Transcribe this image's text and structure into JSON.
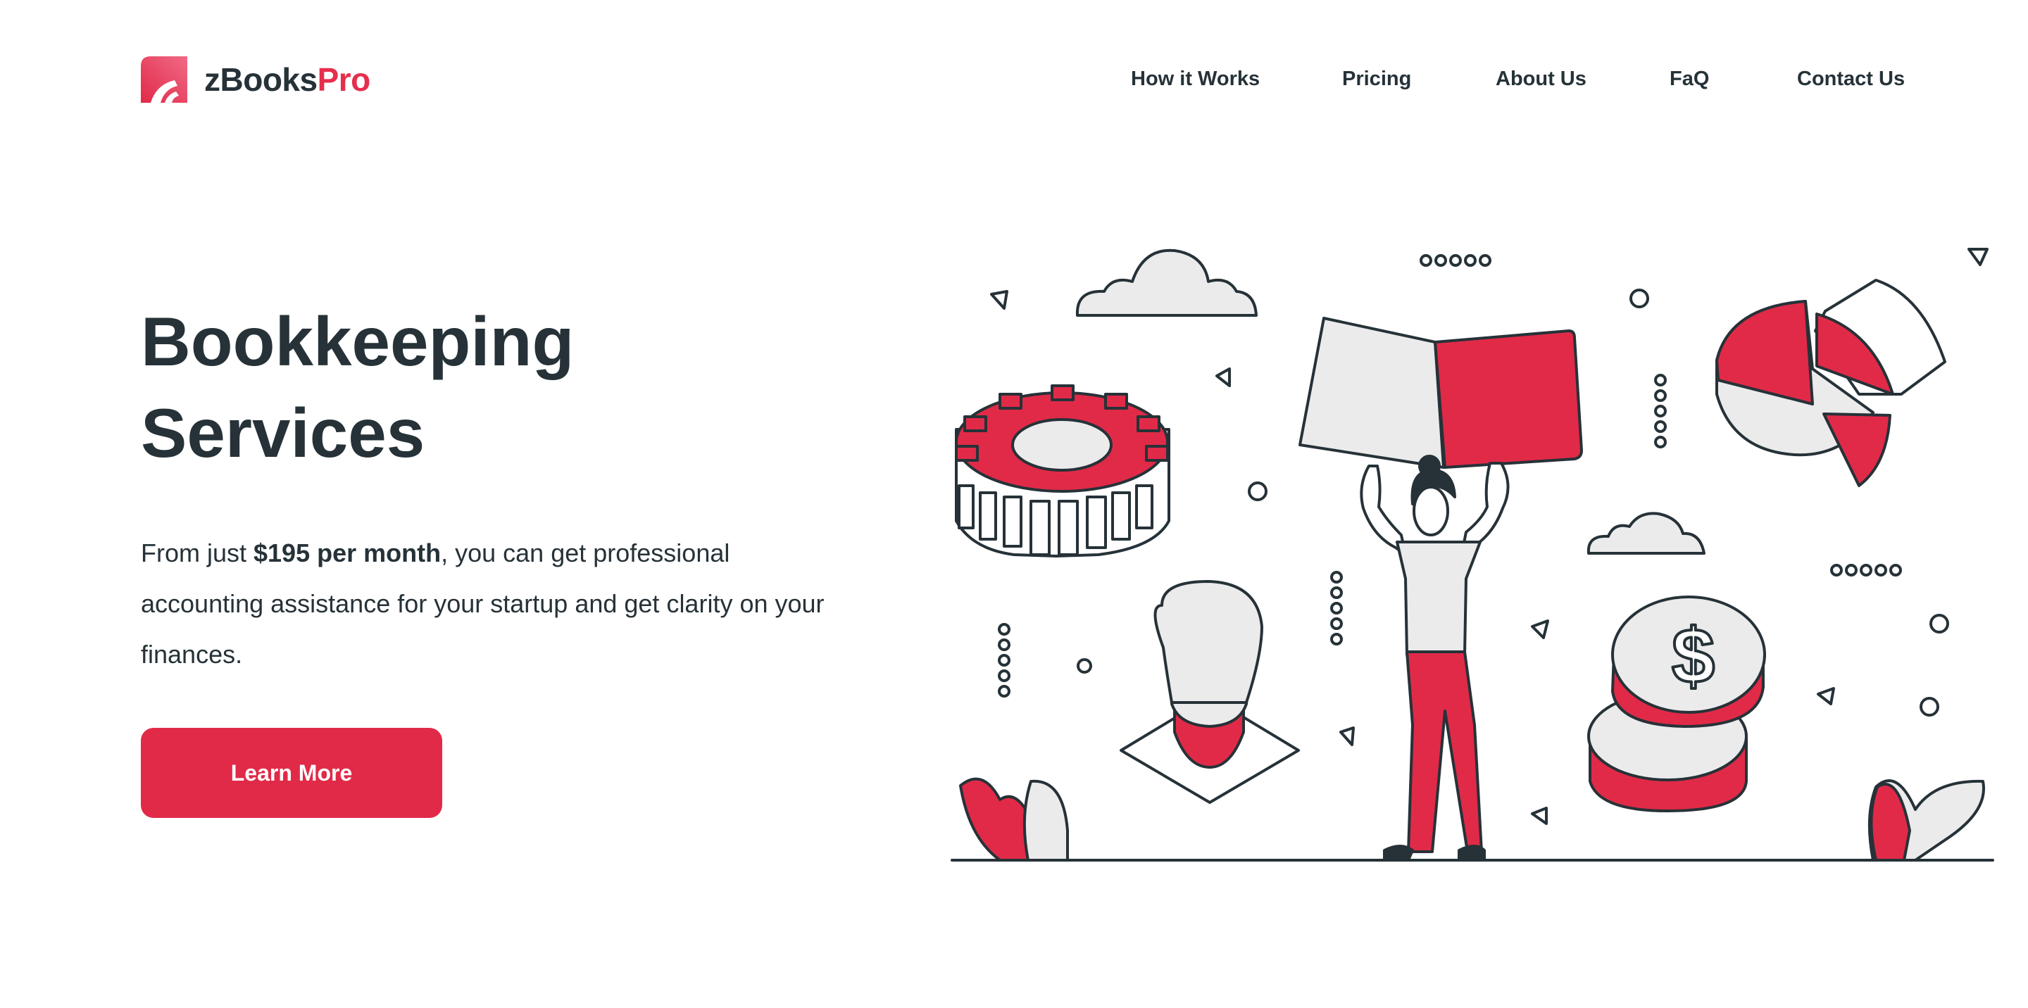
{
  "brand": {
    "name_main": "zBooks",
    "name_accent": "Pro",
    "accent_color": "#e62e4d"
  },
  "nav": {
    "items": [
      {
        "label": "How it Works"
      },
      {
        "label": "Pricing"
      },
      {
        "label": "About Us"
      },
      {
        "label": "FaQ"
      },
      {
        "label": "Contact Us"
      }
    ]
  },
  "hero": {
    "title_line1": "Bookkeeping",
    "title_line2": "Services",
    "desc_prefix": "From just ",
    "desc_price": "$195 per month",
    "desc_suffix": ", you can get professional accounting assistance for your startup and get clarity on your finances.",
    "cta_label": "Learn More"
  },
  "illustration": {
    "icons": [
      "gear-icon",
      "lightbulb-icon",
      "books-icon",
      "pie-chart-icon",
      "coins-icon",
      "cloud-icon",
      "plant-icon",
      "person-icon"
    ],
    "primary_color": "#e12a48",
    "line_color": "#263238",
    "fill_color": "#ebebeb"
  }
}
